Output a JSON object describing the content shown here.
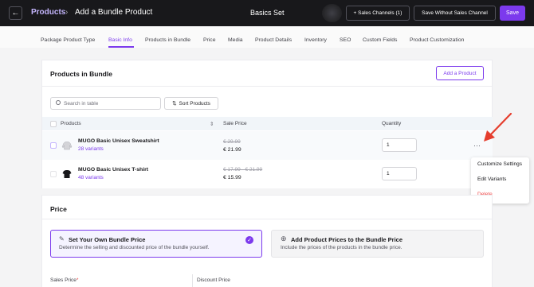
{
  "topbar": {
    "back_icon": "←",
    "breadcrumb_root": "Products",
    "breadcrumb_sep": "›",
    "breadcrumb_title": "Add a Bundle Product",
    "center_title": "Basics Set",
    "sales_channels_label": "+ Sales Channels (1)",
    "save_without_label": "Save Without Sales Channel",
    "save_label": "Save"
  },
  "tabs": [
    {
      "label": "Package Product Type"
    },
    {
      "label": "Basic Info"
    },
    {
      "label": "Products in Bundle"
    },
    {
      "label": "Price"
    },
    {
      "label": "Media"
    },
    {
      "label": "Product Details"
    },
    {
      "label": "Inventory"
    },
    {
      "label": "SEO"
    },
    {
      "label": "Custom Fields"
    },
    {
      "label": "Product Customization"
    }
  ],
  "bundle": {
    "title": "Products in Bundle",
    "add_product_label": "Add a Product",
    "search_placeholder": "Search in table",
    "sort_label": "Sort Products",
    "sort_icon": "⇅",
    "columns": {
      "products": "Products",
      "sort_icon": "⇕",
      "sale_price": "Sale Price",
      "quantity": "Quantity"
    },
    "rows": [
      {
        "name": "MUGO Basic Unisex Sweatshirt",
        "variants": "28 variants",
        "old_price": "€ 29.99",
        "new_price": "€ 21.99",
        "quantity": "1"
      },
      {
        "name": "MUGO Basic Unisex T-shirt",
        "variants": "48 variants",
        "old_price": "€ 17.99  -  € 21.99",
        "new_price": "€ 15.99",
        "quantity": "1"
      }
    ],
    "more_icon": "···"
  },
  "menu": {
    "items": [
      "Customize Settings",
      "Edit Variants",
      "Delete"
    ]
  },
  "price": {
    "title": "Price",
    "option1": {
      "icon": "✎",
      "title": "Set Your Own Bundle Price",
      "desc": "Determine the selling and discounted price of the bundle yourself.",
      "check": "✓"
    },
    "option2": {
      "icon": "⊕",
      "title": "Add Product Prices to the Bundle Price",
      "desc": "Include the prices of the products in the bundle price."
    },
    "sales_price_label": "Sales Price",
    "required_mark": "*",
    "discount_price_label": "Discount Price"
  },
  "colors": {
    "accent": "#7c3aed",
    "danger": "#ef4444",
    "annotation": "#e53e2e"
  }
}
